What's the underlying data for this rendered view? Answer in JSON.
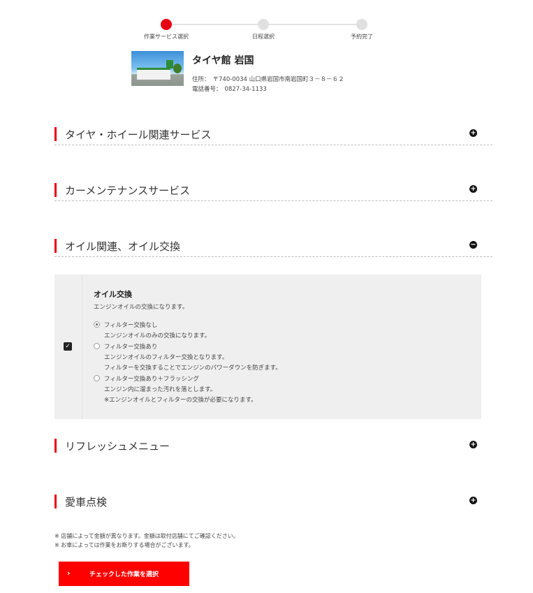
{
  "stepper": {
    "steps": [
      {
        "label": "作業サービス選択",
        "active": true
      },
      {
        "label": "日程選択",
        "active": false
      },
      {
        "label": "予約完了",
        "active": false
      }
    ],
    "active_color": "#e60012"
  },
  "shop": {
    "name": "タイヤ館 岩国",
    "address_label": "住所：",
    "address": "〒740-0034 山口県岩国市南岩国町３－８－６２",
    "phone_label": "電話番号：",
    "phone": "0827-34-1133"
  },
  "categories": [
    {
      "title": "タイヤ・ホイール関連サービス",
      "toggle": "+",
      "expanded": false
    },
    {
      "title": "カーメンテナンスサービス",
      "toggle": "+",
      "expanded": false
    },
    {
      "title": "オイル関連、オイル交換",
      "toggle": "−",
      "expanded": true
    },
    {
      "title": "リフレッシュメニュー",
      "toggle": "+",
      "expanded": false
    },
    {
      "title": "愛車点検",
      "toggle": "+",
      "expanded": false
    }
  ],
  "oil_service": {
    "checkbox": "✓",
    "checked": true,
    "title": "オイル交換",
    "desc": "エンジンオイルの交換になります。",
    "options": [
      {
        "label": "フィルター交換なし",
        "checked": true,
        "desc": [
          "エンジンオイルのみの交換になります。"
        ]
      },
      {
        "label": "フィルター交換あり",
        "checked": false,
        "desc": [
          "エンジンオイルのフィルター交換となります。",
          "フィルターを交換することでエンジンのパワーダウンを防ぎます。"
        ]
      },
      {
        "label": "フィルター交換あり＋フラッシング",
        "checked": false,
        "desc": [
          "エンジン内に溜まった汚れを落とします。",
          "※エンジンオイルとフィルターの交換が必要になります。"
        ]
      }
    ]
  },
  "notes": [
    "※ 店舗によって金額が異なります。金額は取付店舗にてご確認ください。",
    "※ お車によっては作業をお断りする場合がございます。"
  ],
  "submit": {
    "chevron": "›",
    "label": "チェックした作業を選択",
    "color": "#ff0000"
  }
}
